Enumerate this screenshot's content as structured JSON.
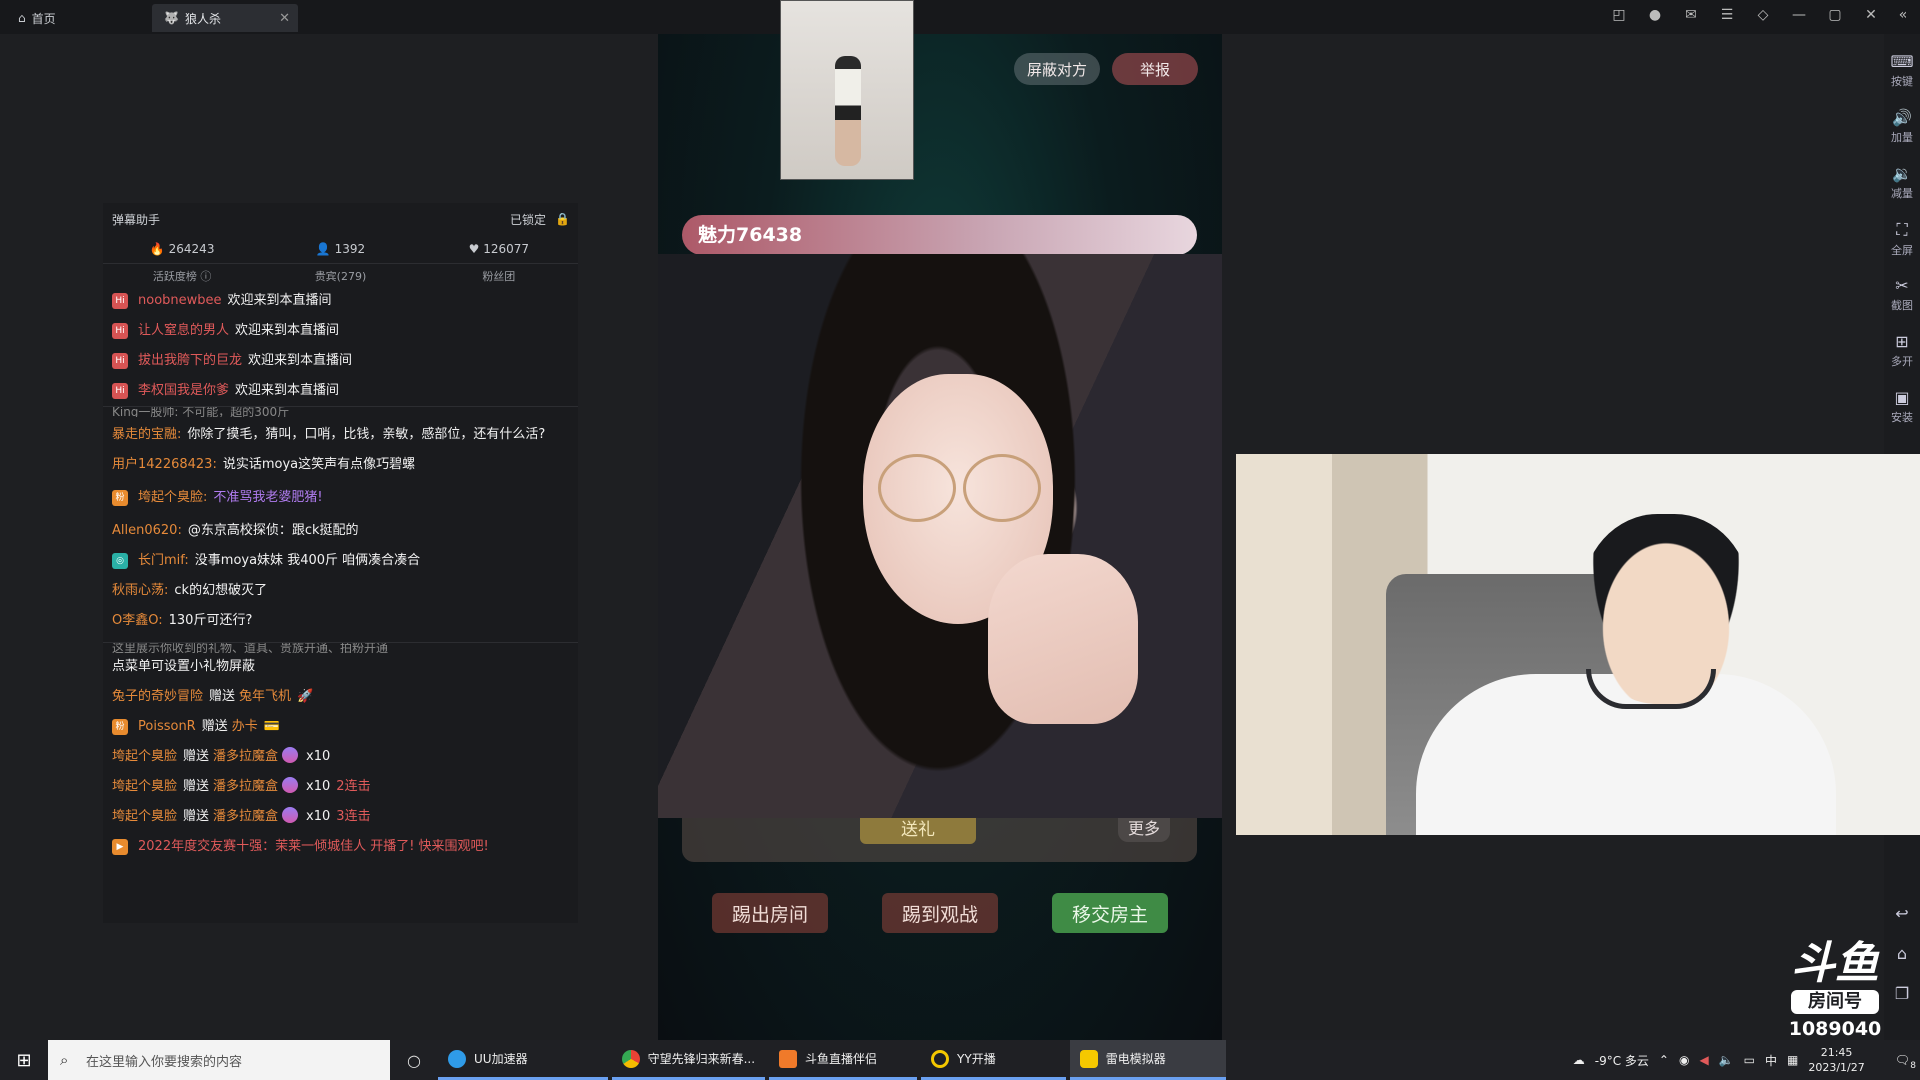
{
  "tabs": {
    "home": "首页",
    "active": "狼人杀"
  },
  "right_tools": [
    {
      "icon": "keyboard-icon",
      "label": "按键"
    },
    {
      "icon": "volume-up-icon",
      "label": "加量"
    },
    {
      "icon": "volume-down-icon",
      "label": "减量"
    },
    {
      "icon": "fullscreen-icon",
      "label": "全屏"
    },
    {
      "icon": "scissors-icon",
      "label": "截图"
    },
    {
      "icon": "multi-open-icon",
      "label": "多开"
    },
    {
      "icon": "apk-icon",
      "label": "安装"
    }
  ],
  "live": {
    "block_btn": "屏蔽对方",
    "report_btn": "举报",
    "charm": "魅力76438",
    "send_gift": "送礼",
    "more": "更多",
    "kick_room": "踢出房间",
    "kick_watch": "踢到观战",
    "transfer_host": "移交房主"
  },
  "chat": {
    "title": "弹幕助手",
    "locked": "已锁定",
    "stats": {
      "likes": "264243",
      "viewers": "1392",
      "hearts": "126077"
    },
    "subtabs": [
      "活跃度榜",
      "贵宾(279)",
      "粉丝团"
    ],
    "welcome": [
      {
        "user": "noobnewbee",
        "msg": "欢迎来到本直播间"
      },
      {
        "user": "让人窒息的男人",
        "msg": "欢迎来到本直播间"
      },
      {
        "user": "拔出我胯下的巨龙",
        "msg": "欢迎来到本直播间"
      },
      {
        "user": "李权国我是你爹",
        "msg": "欢迎来到本直播间"
      }
    ],
    "cut_top": "King一股帅:   不可能，超的300斤",
    "danmu": [
      {
        "user": "暴走的宝融:",
        "msg": "你除了摸毛，猜叫，口哨，比钱，亲敏，感部位，还有什么活?",
        "badge": ""
      },
      {
        "user": "用户142268423:",
        "msg": "说实话moya这笑声有点像巧碧螺",
        "badge": ""
      },
      {
        "user": "垮起个臭脸:",
        "msg": "不准骂我老婆肥猪!",
        "badge": "org",
        "purple": true
      },
      {
        "user": "Allen0620:",
        "msg": "@东京高校探侦：跟ck挺配的",
        "badge": ""
      },
      {
        "user": "长门mif:",
        "msg": "没事moya妹妹 我400斤 咱俩凑合凑合",
        "badge": "teal"
      },
      {
        "user": "秋雨心荡:",
        "msg": "ck的幻想破灭了",
        "badge": ""
      },
      {
        "user": "O李鑫O:",
        "msg": "130斤可还行?",
        "badge": ""
      }
    ],
    "cut_mid": "这里展示你收到的礼物、道具、贵族开通、拍粉开通",
    "gift_hint": "点菜单可设置小礼物屏蔽",
    "gifts": [
      {
        "user": "兔子的奇妙冒险",
        "action": "赠送",
        "item": "兔年飞机",
        "qty": "",
        "combo": ""
      },
      {
        "user": "PoissonR",
        "action": "赠送",
        "item": "办卡",
        "qty": "",
        "combo": ""
      },
      {
        "user": "垮起个臭脸",
        "action": "赠送",
        "item": "潘多拉魔盒",
        "qty": "x10",
        "combo": ""
      },
      {
        "user": "垮起个臭脸",
        "action": "赠送",
        "item": "潘多拉魔盒",
        "qty": "x10",
        "combo": "2连击"
      },
      {
        "user": "垮起个臭脸",
        "action": "赠送",
        "item": "潘多拉魔盒",
        "qty": "x10",
        "combo": "3连击"
      }
    ],
    "notice": "2022年度交友赛十强：茉莱一倾城佳人 开播了! 快来围观吧!"
  },
  "douyu": {
    "brand": "斗鱼",
    "room_label": "房间号",
    "room_no": "1089040"
  },
  "taskbar": {
    "search_placeholder": "在这里输入你要搜索的内容",
    "tasks": [
      {
        "label": "UU加速器",
        "color": "#2f9be8"
      },
      {
        "label": "守望先锋归来新春...",
        "color": "#e8a53a"
      },
      {
        "label": "斗鱼直播伴侣",
        "color": "#f07a2a"
      },
      {
        "label": "YY开播",
        "color": "#f5c800"
      },
      {
        "label": "雷电模拟器",
        "color": "#f5c800"
      }
    ],
    "weather": "-9°C  多云",
    "ime": "中",
    "time": "21:45",
    "date": "2023/1/27",
    "notify_count": "8"
  },
  "colors": {
    "accent_orange": "#e68a3a",
    "user_red": "#e05a5a",
    "transfer_green": "#3f8b45"
  }
}
